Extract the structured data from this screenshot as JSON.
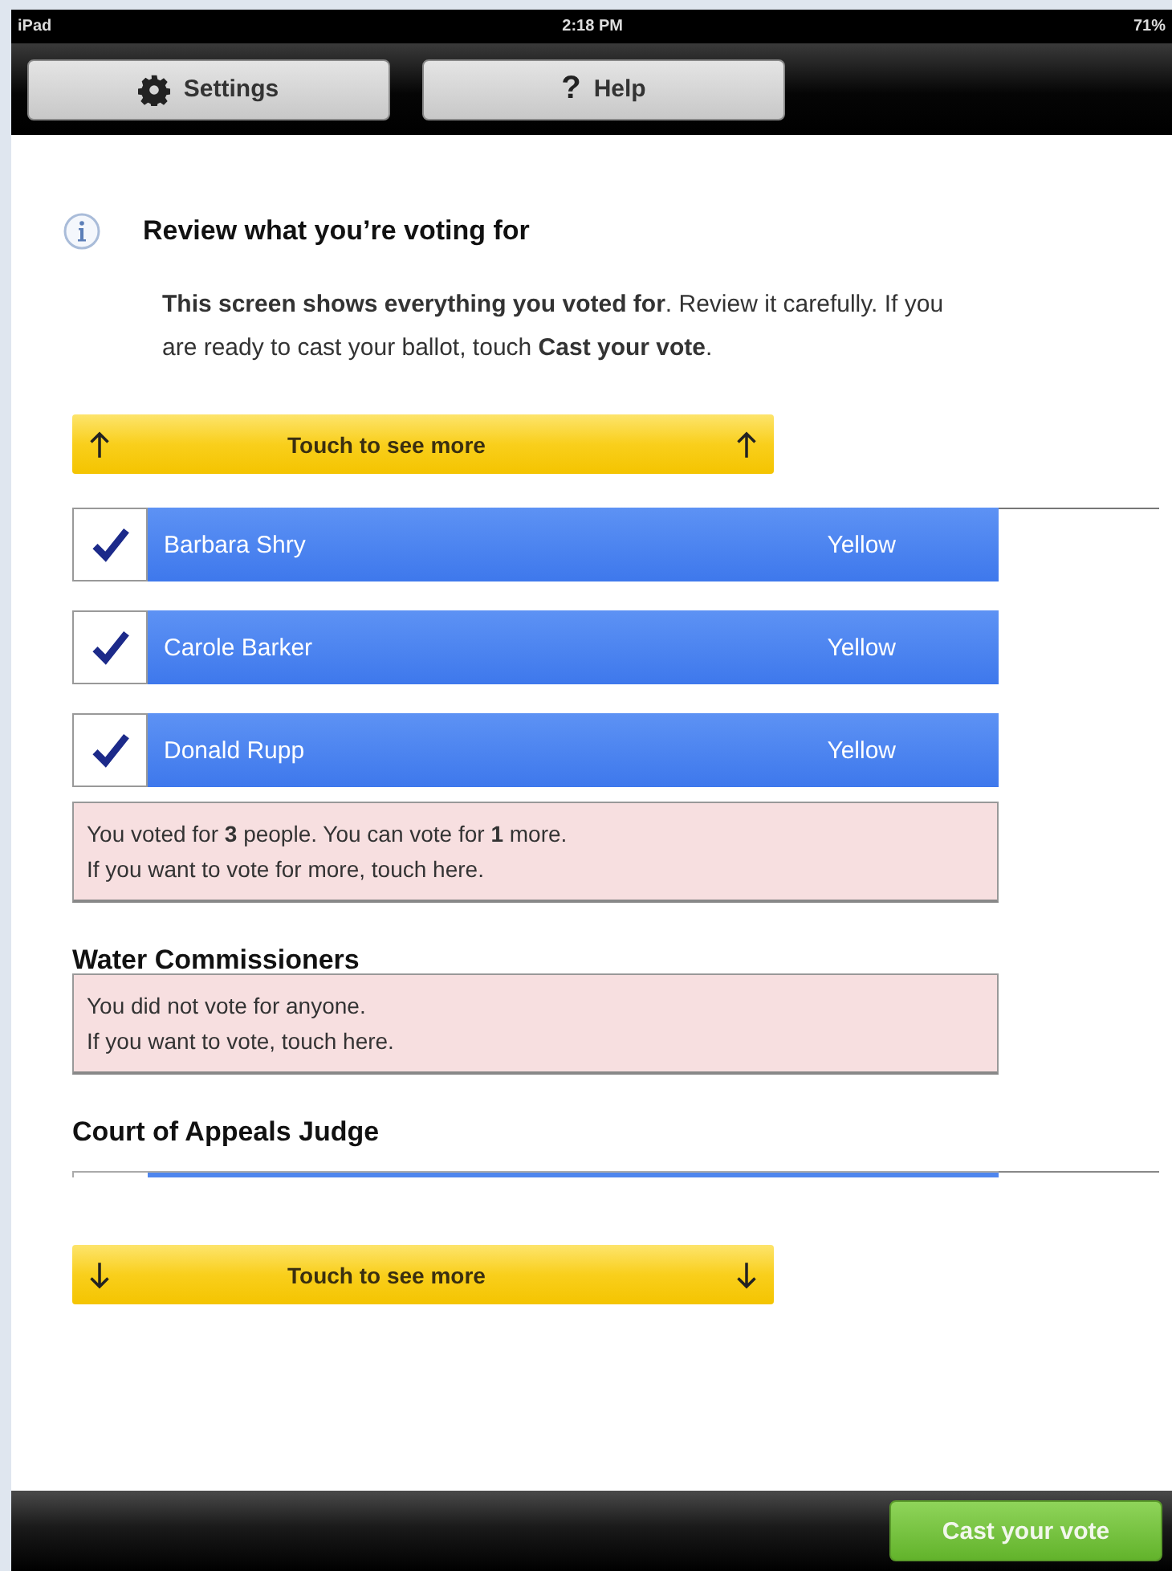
{
  "status_bar": {
    "device": "iPad",
    "time": "2:18 PM",
    "battery": "71%"
  },
  "toolbar": {
    "buttons": [
      {
        "kind": "gear",
        "label": "Settings"
      },
      {
        "kind": "glyph",
        "glyph": "?",
        "label": "Help"
      }
    ]
  },
  "heading": "Review what you’re voting for",
  "intro": "**This screen shows everything you voted for**. Review it carefully. If you are ready to cast your ballot, touch **Cast your vote**.",
  "scroll_up": {
    "label": "Touch to see more",
    "kind": "up"
  },
  "contests": [
    {
      "candidates": [
        {
          "name": "Barbara Shry",
          "party": "Yellow",
          "checked": true
        },
        {
          "name": "Carole Barker",
          "party": "Yellow",
          "checked": true
        },
        {
          "name": "Donald Rupp",
          "party": "Yellow",
          "checked": true
        }
      ],
      "notice": [
        "You voted for **3** people. You can vote for **1** more.",
        "If you want to vote for more, touch here."
      ]
    },
    {
      "title": "Water Commissioners",
      "notice": [
        "You did not vote for anyone.",
        "If you want to vote, touch here."
      ]
    },
    {
      "title": "Court of Appeals Judge",
      "partial_row": true
    }
  ],
  "scroll_down": {
    "label": "Touch to see more",
    "kind": "down"
  },
  "cast_button": {
    "label": "Cast your vote"
  }
}
